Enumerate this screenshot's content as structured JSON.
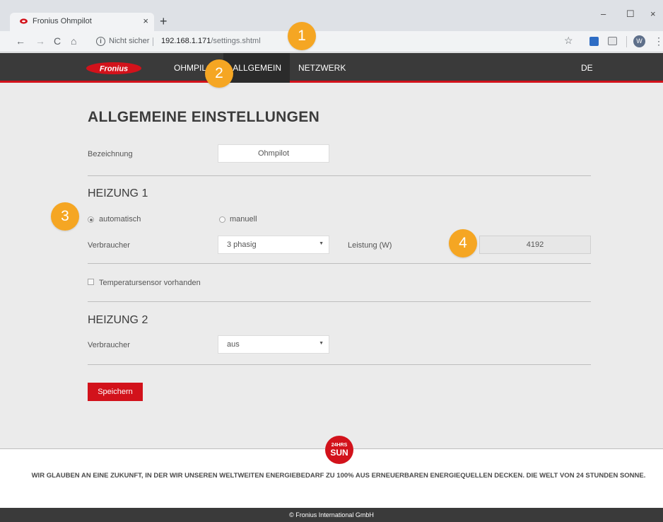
{
  "browser": {
    "tab_title": "Fronius Ohmpilot",
    "tab_close": "×",
    "new_tab": "+",
    "window_min": "–",
    "window_max": "☐",
    "window_close": "×",
    "back": "←",
    "forward": "→",
    "reload": "C",
    "home": "⌂",
    "security_info_icon": "i",
    "security_label": "Nicht sicher",
    "url_host": "192.168.1.171",
    "url_path": "/settings.shtml",
    "star": "☆",
    "profile_initial": "W",
    "menu": "⋮"
  },
  "icons": {
    "favicon": "fronius-favicon",
    "info": "info-icon",
    "bookmark": "star-icon",
    "extension1": "extension-icon",
    "extension2": "cast-icon"
  },
  "nav": {
    "brand": "Fronius",
    "items": [
      {
        "label": "OHMPILOT"
      },
      {
        "label": "ALLGEMEIN",
        "active": true
      },
      {
        "label": "NETZWERK"
      }
    ],
    "language": "DE"
  },
  "page": {
    "title": "ALLGEMEINE EINSTELLUNGEN",
    "bezeichnung_label": "Bezeichnung",
    "bezeichnung_value": "Ohmpilot",
    "heizung1": {
      "title": "HEIZUNG 1",
      "mode_auto": "automatisch",
      "mode_manual": "manuell",
      "mode_selected": "automatisch",
      "verbraucher_label": "Verbraucher",
      "verbraucher_value": "3 phasig",
      "leistung_label": "Leistung (W)",
      "leistung_value": "4192",
      "temp_sensor_label": "Temperatursensor vorhanden",
      "temp_sensor_checked": false
    },
    "heizung2": {
      "title": "HEIZUNG 2",
      "verbraucher_label": "Verbraucher",
      "verbraucher_value": "aus"
    },
    "save_label": "Speichern",
    "select_arrow": "▼"
  },
  "footer": {
    "badge_top": "24HRS",
    "badge_bottom": "SUN",
    "slogan": "WIR GLAUBEN AN EINE ZUKUNFT, IN DER WIR UNSEREN WELTWEITEN ENERGIEBEDARF ZU 100% AUS ERNEUERBAREN ENERGIEQUELLEN DECKEN. DIE WELT VON 24 STUNDEN SONNE.",
    "copyright": "© Fronius International GmbH"
  },
  "callouts": [
    "1",
    "2",
    "3",
    "4"
  ],
  "colors": {
    "brand_red": "#d2121b",
    "nav_bg": "#3a3a3a",
    "content_bg": "#ebebeb",
    "callout": "#f5a623"
  }
}
